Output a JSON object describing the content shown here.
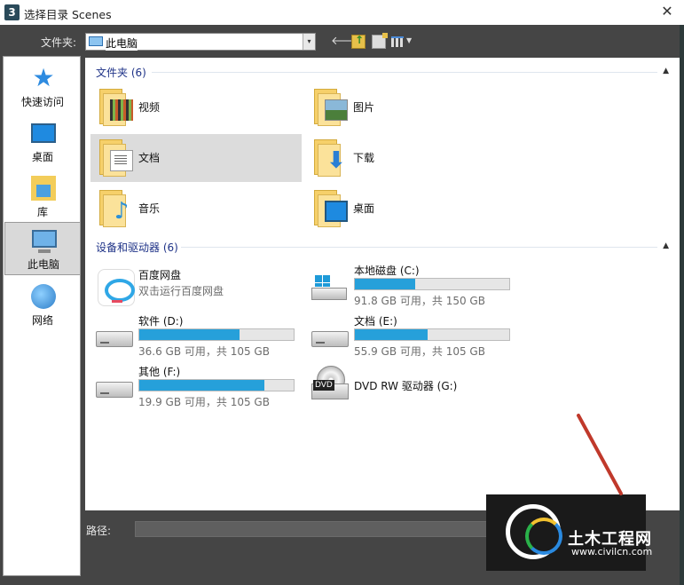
{
  "titlebar": {
    "icon": "3",
    "title": "选择目录 Scenes",
    "close": "✕"
  },
  "toolbar": {
    "folder_label": "文件夹:",
    "path_value": "此电脑",
    "dropdown_arrow": "▾",
    "buttons": [
      "back-icon",
      "up-folder-icon",
      "new-folder-icon",
      "view-menu-icon"
    ]
  },
  "places": [
    {
      "label": "快速访问",
      "icon": "star-icon",
      "selected": false
    },
    {
      "label": "桌面",
      "icon": "desktop-icon",
      "selected": false
    },
    {
      "label": "库",
      "icon": "library-icon",
      "selected": false
    },
    {
      "label": "此电脑",
      "icon": "computer-icon",
      "selected": true
    },
    {
      "label": "网络",
      "icon": "network-icon",
      "selected": false
    }
  ],
  "folders_group": {
    "header": "文件夹 (6)",
    "items": [
      {
        "name": "视频",
        "icon": "video-folder-icon"
      },
      {
        "name": "图片",
        "icon": "pictures-folder-icon"
      },
      {
        "name": "文档",
        "icon": "documents-folder-icon",
        "selected": true
      },
      {
        "name": "下载",
        "icon": "downloads-folder-icon"
      },
      {
        "name": "音乐",
        "icon": "music-folder-icon"
      },
      {
        "name": "桌面",
        "icon": "desktop-folder-icon"
      }
    ]
  },
  "devices_group": {
    "header": "设备和驱动器 (6)",
    "items": [
      {
        "name": "百度网盘",
        "info": "双击运行百度网盘",
        "icon": "baidu-netdisk-icon"
      },
      {
        "name": "本地磁盘 (C:)",
        "info": "91.8 GB 可用，共 150 GB",
        "used_fraction": 0.39,
        "icon": "windows-drive-icon"
      },
      {
        "name": "软件 (D:)",
        "info": "36.6 GB 可用，共 105 GB",
        "used_fraction": 0.65,
        "icon": "hard-drive-icon"
      },
      {
        "name": "文档 (E:)",
        "info": "55.9 GB 可用，共 105 GB",
        "used_fraction": 0.47,
        "icon": "hard-drive-icon"
      },
      {
        "name": "其他 (F:)",
        "info": "19.9 GB 可用，共 105 GB",
        "used_fraction": 0.81,
        "icon": "hard-drive-icon"
      },
      {
        "name": "DVD RW 驱动器 (G:)",
        "icon": "dvd-drive-icon",
        "badge": "DVD"
      }
    ]
  },
  "bottom": {
    "path_label": "路径:",
    "path_value": ""
  },
  "watermark": {
    "name": "土木工程网",
    "url": "www.civilcn.com"
  },
  "colors": {
    "accent": "#26a0da",
    "group_header": "#1e3287",
    "dark_bg": "#454545",
    "annotation_arrow": "#c0392b"
  }
}
